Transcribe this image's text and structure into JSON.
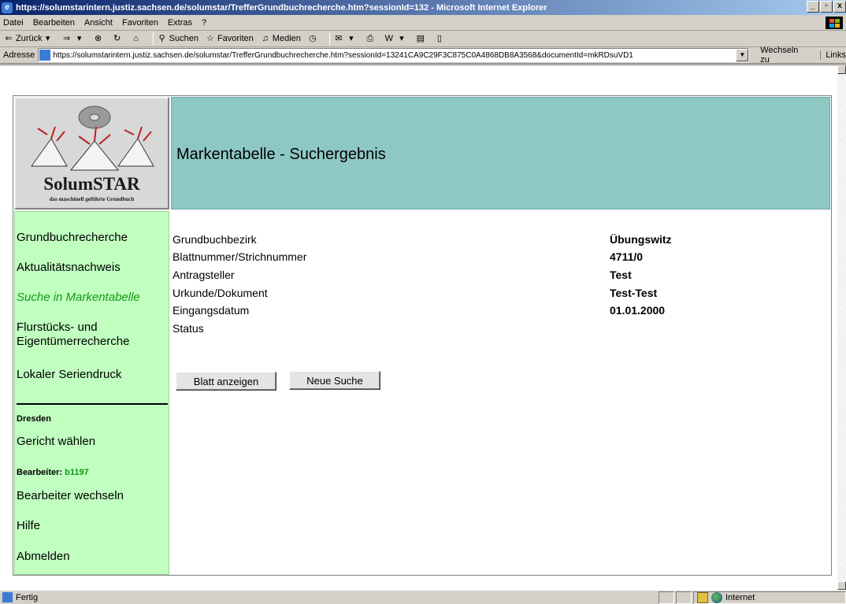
{
  "window": {
    "title": "https://solumstarintern.justiz.sachsen.de/solumstar/TrefferGrundbuchrecherche.htm?sessionId=132 - Microsoft Internet Explorer"
  },
  "menu": [
    "Datei",
    "Bearbeiten",
    "Ansicht",
    "Favoriten",
    "Extras",
    "?"
  ],
  "toolbar": {
    "back": "Zurück",
    "search": "Suchen",
    "favorites": "Favoriten",
    "media": "Medien"
  },
  "address": {
    "label": "Adresse",
    "url": "https://solumstarintern.justiz.sachsen.de/solumstar/TrefferGrundbuchrecherche.htm?sessionId=13241CA9C29F3C875C0A4868DB8A3568&documentId=mkRDsuVD1",
    "go": "Wechseln zu",
    "links": "Links"
  },
  "logo": {
    "name": "SolumSTAR",
    "subtitle": "das maschinell geführte Grundbuch"
  },
  "header": {
    "title": "Markentabelle - Suchergebnis"
  },
  "sidebar": {
    "items": [
      "Grundbuchrecherche",
      "Aktualitätsnachweis",
      "Suche in Markentabelle",
      "Flurstücks- und",
      "Eigentümerrecherche",
      "Lokaler Seriendruck"
    ],
    "court_name": "Dresden",
    "choose_court": "Gericht wählen",
    "user_label": "Bearbeiter:",
    "user_id": "b1197",
    "switch_user": "Bearbeiter wechseln",
    "help": "Hilfe",
    "logout": "Abmelden"
  },
  "result": {
    "rows": [
      {
        "label": "Grundbuchbezirk",
        "value": "Übungswitz"
      },
      {
        "label": "Blattnummer/Strichnummer",
        "value": "4711/0"
      },
      {
        "label": "Antragsteller",
        "value": "Test"
      },
      {
        "label": "Urkunde/Dokument",
        "value": "Test-Test"
      },
      {
        "label": "Eingangsdatum",
        "value": "01.01.2000"
      },
      {
        "label": "Status",
        "value": ""
      }
    ],
    "show_sheet_button": "Blatt anzeigen",
    "new_search_button": "Neue Suche"
  },
  "status": {
    "text": "Fertig",
    "zone": "Internet"
  },
  "colors": {
    "header_bg": "#8ec8c4",
    "sidebar_bg": "#c0ffc0",
    "active_link": "#119911"
  }
}
